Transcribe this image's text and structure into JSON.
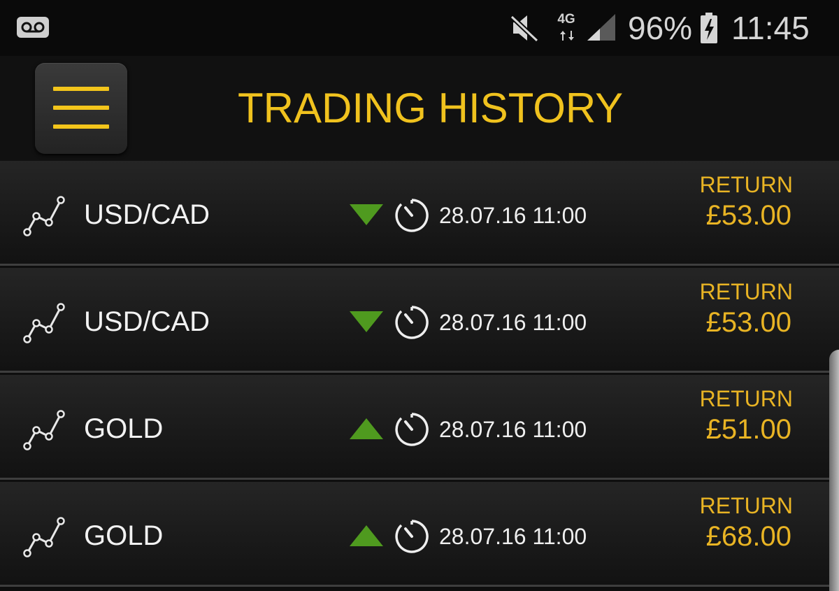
{
  "status_bar": {
    "network_type": "4G",
    "battery_percent": "96%",
    "time": "11:45",
    "icons": [
      "voicemail-icon",
      "mute-icon",
      "network-arrows-icon",
      "signal-icon",
      "battery-charging-icon"
    ]
  },
  "header": {
    "title": "TRADING HISTORY",
    "menu_icon": "hamburger-menu-icon"
  },
  "colors": {
    "accent": "#f0c21e",
    "return_text": "#e9b424",
    "direction_arrow": "#4f9a1f",
    "background": "#0e0e0e"
  },
  "trades": [
    {
      "asset": "USD/CAD",
      "direction": "down",
      "expiry": "28.07.16 11:00",
      "return_label": "RETURN",
      "return_value": "£53.00"
    },
    {
      "asset": "USD/CAD",
      "direction": "down",
      "expiry": "28.07.16 11:00",
      "return_label": "RETURN",
      "return_value": "£53.00"
    },
    {
      "asset": "GOLD",
      "direction": "up",
      "expiry": "28.07.16 11:00",
      "return_label": "RETURN",
      "return_value": "£51.00"
    },
    {
      "asset": "GOLD",
      "direction": "up",
      "expiry": "28.07.16 11:00",
      "return_label": "RETURN",
      "return_value": "£68.00"
    }
  ]
}
